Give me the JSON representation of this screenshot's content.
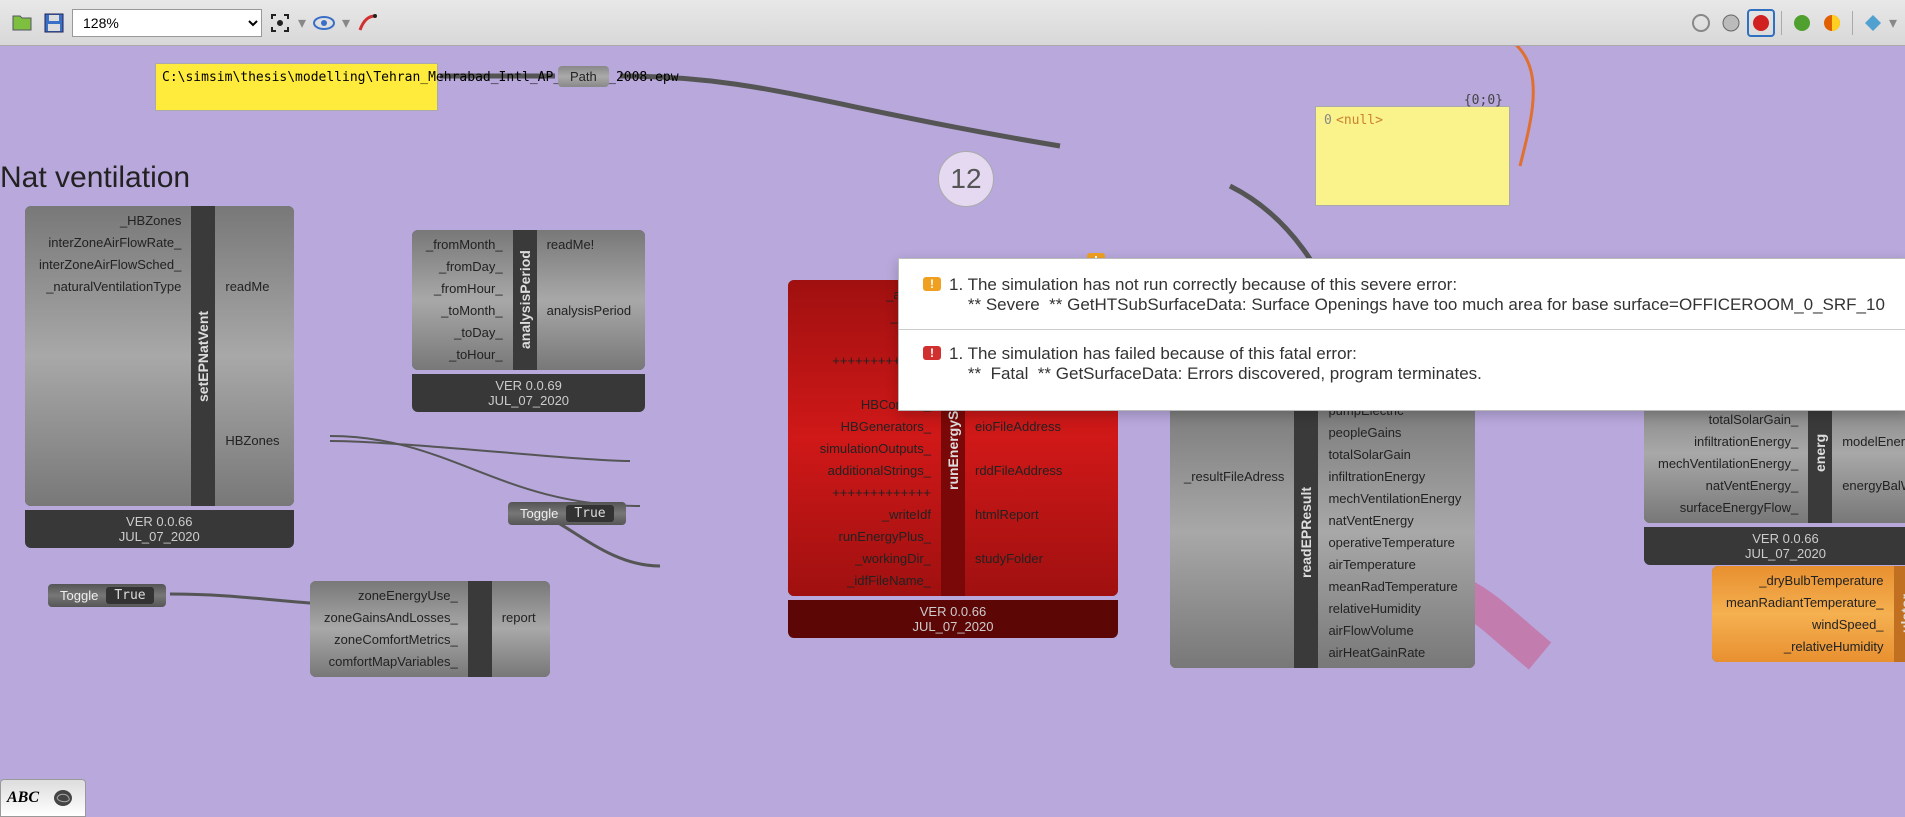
{
  "toolbar": {
    "zoom": "128%"
  },
  "canvas": {
    "title": "Nat ventilation",
    "badge": "12"
  },
  "sticky1": {
    "text": "C:\\simsim\\thesis\\modelling\\Tehran_Mehrabad_Intl_AP_TE_IRN_2008.epw"
  },
  "sticky2": {
    "origin": "0",
    "body": "<null>",
    "coords": "{0;0}"
  },
  "path_tag": "Path",
  "toggle1": {
    "label": "Toggle",
    "value": "True"
  },
  "toggle2": {
    "label": "Toggle",
    "value": "True"
  },
  "setEPNatVent": {
    "label": "setEPNatVent",
    "inputs": [
      "_HBZones",
      "interZoneAirFlowRate_",
      "interZoneAirFlowSched_",
      "_naturalVentilationType"
    ],
    "outputs": [
      "readMe",
      "",
      "",
      "",
      "",
      "",
      "",
      "",
      "",
      "",
      "HBZones"
    ],
    "ver": "VER 0.0.66",
    "date": "JUL_07_2020"
  },
  "analysisPeriod": {
    "label": "analysisPeriod",
    "inputs": [
      "_fromMonth_",
      "_fromDay_",
      "_fromHour_",
      "_toMonth_",
      "_toDay_",
      "_toHour_"
    ],
    "outputs": [
      "readMe!",
      "",
      "",
      "analysisPeriod"
    ],
    "ver": "VER 0.0.69",
    "date": "JUL_07_2020"
  },
  "runEnergySim": {
    "label": "runEnergySimu",
    "inputs": [
      "_analys",
      "_energ",
      "",
      "+++++++++++++",
      "",
      "HBContext_",
      "HBGenerators_",
      "simulationOutputs_",
      "additionalStrings_",
      "+++++++++++++",
      "_writeIdf",
      "runEnergyPlus_",
      "_workingDir_",
      "_idfFileName_"
    ],
    "outputs": [
      "",
      "",
      "",
      "",
      "",
      "",
      "eioFileAddress",
      "",
      "rddFileAddress",
      "",
      "htmlReport",
      "",
      "studyFolder"
    ],
    "ver": "VER 0.0.66",
    "date": "JUL_07_2020"
  },
  "readEPResult": {
    "label": "readEPResult",
    "inputs": [
      "_resultFileAdress"
    ],
    "outputs": [
      "pumpElectric",
      "peopleGains",
      "totalSolarGain",
      "infiltrationEnergy",
      "mechVentilationEnergy",
      "natVentEnergy",
      "operativeTemperature",
      "airTemperature",
      "meanRadTemperature",
      "relativeHumidity",
      "airFlowVolume",
      "airHeatGainRate"
    ],
    "ver": "",
    "date": ""
  },
  "energyPartial": {
    "label": "energ",
    "outputs": [
      "peopleGains_",
      "totalSolarGain_",
      "infiltrationEnergy_",
      "mechVentilationEnergy_",
      "natVentEnergy_",
      "surfaceEnergyFlow_"
    ],
    "inputs_r": [
      "",
      "",
      "",
      "modelEnerg",
      "",
      "energyBalW"
    ],
    "ver": "VER 0.0.66",
    "date": "JUL_07_2020"
  },
  "comfPartial": {
    "label": "ulator",
    "inputs": [
      "_dryBulbTemperature",
      "meanRadiantTemperature_",
      "windSpeed_",
      "_relativeHumidity"
    ]
  },
  "zoneComp": {
    "inputs": [
      "zoneEnergyUse_",
      "zoneGainsAndLosses_",
      "zoneComfortMetrics_",
      "comfortMapVariables_"
    ],
    "output": "report"
  },
  "tooltip": {
    "l1a": "1. The simulation has not run correctly because of this severe error:",
    "l1b": "    ** Severe  ** GetHTSubSurfaceData: Surface Openings have too much area for base surface=OFFICEROOM_0_SRF_10",
    "l2a": "1. The simulation has failed because of this fatal error:",
    "l2b": "    **  Fatal  ** GetSurfaceData: Errors discovered, program terminates."
  }
}
